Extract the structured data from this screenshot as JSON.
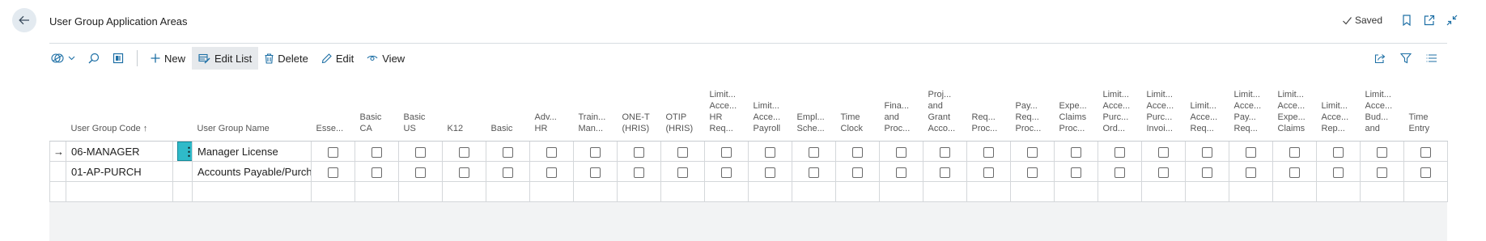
{
  "header": {
    "title": "User Group Application Areas",
    "saved_label": "Saved"
  },
  "toolbar": {
    "new_label": "New",
    "edit_list_label": "Edit List",
    "delete_label": "Delete",
    "edit_label": "Edit",
    "view_label": "View"
  },
  "grid": {
    "code_header": "User Group Code ↑",
    "name_header": "User Group Name",
    "app_columns": [
      "Esse...",
      "Basic CA",
      "Basic US",
      "K12",
      "Basic",
      "Adv... HR",
      "Train... Man...",
      "ONE-T (HRIS)",
      "OTIP (HRIS)",
      "Limit... Acce... HR Req...",
      "Limit... Acce... Payroll",
      "Empl... Sche...",
      "Time Clock",
      "Fina... and Proc...",
      "Proj... and Grant Acco...",
      "Req... Proc...",
      "Pay... Req... Proc...",
      "Expe... Claims Proc...",
      "Limit... Acce... Purc... Ord...",
      "Limit... Acce... Purc... Invoi...",
      "Limit... Acce... Req...",
      "Limit... Acce... Pay... Req...",
      "Limit... Acce... Expe... Claims",
      "Limit... Acce... Rep...",
      "Limit... Acce... Bud... and",
      "Time Entry"
    ],
    "rows": [
      {
        "indicator": "→",
        "code": "06-MANAGER",
        "name": "Manager License",
        "menu": "⋮"
      },
      {
        "indicator": "",
        "code": "01-AP-PURCH",
        "name": "Accounts Payable/Purchasing",
        "menu": ""
      }
    ]
  }
}
